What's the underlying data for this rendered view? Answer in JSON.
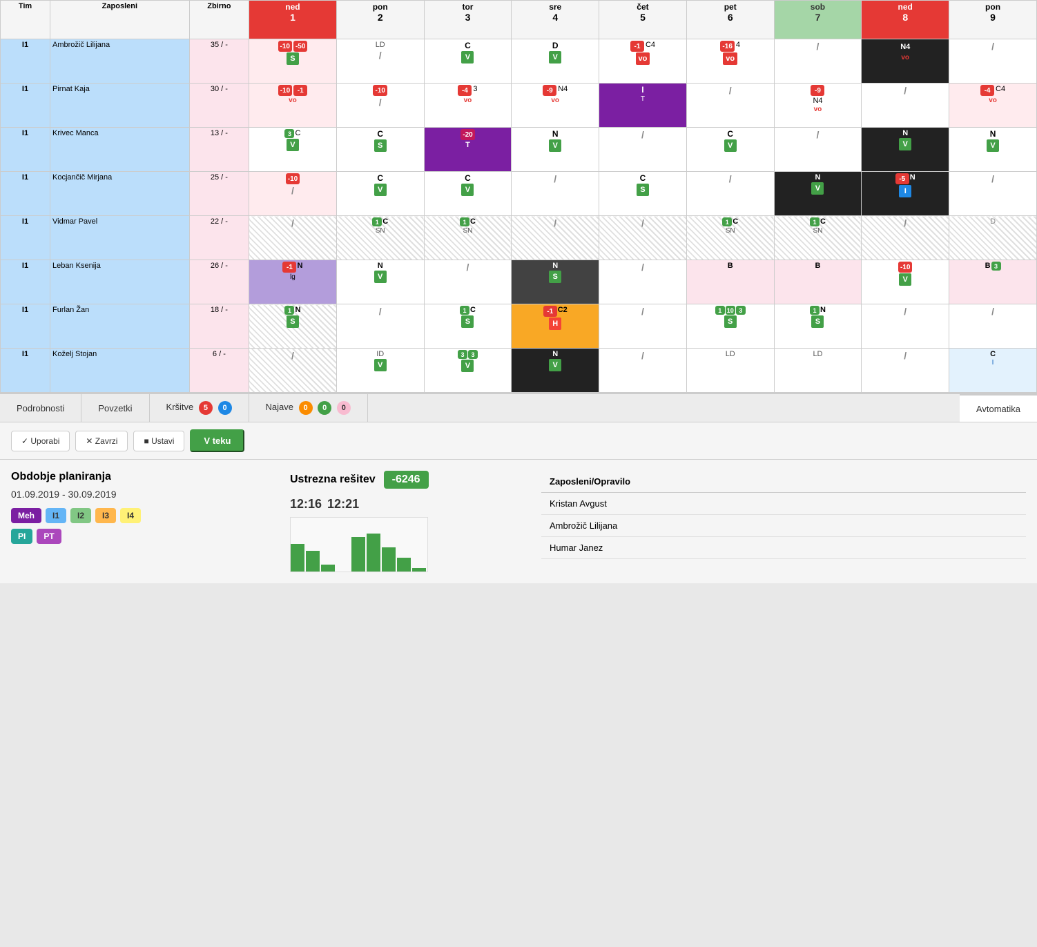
{
  "table": {
    "headers": [
      {
        "label": "Tim",
        "class": "col-tim"
      },
      {
        "label": "Zaposleni",
        "class": "col-zaposleni"
      },
      {
        "label": "Zbirno",
        "class": "col-zbirno"
      },
      {
        "label": "ned",
        "num": "1",
        "class": "header-ned"
      },
      {
        "label": "pon",
        "num": "2",
        "class": ""
      },
      {
        "label": "tor",
        "num": "3",
        "class": ""
      },
      {
        "label": "sre",
        "num": "4",
        "class": ""
      },
      {
        "label": "čet",
        "num": "5",
        "class": ""
      },
      {
        "label": "pet",
        "num": "6",
        "class": ""
      },
      {
        "label": "sob",
        "num": "7",
        "class": "header-sob"
      },
      {
        "label": "ned",
        "num": "8",
        "class": "header-ned"
      },
      {
        "label": "pon",
        "num": "9",
        "class": ""
      }
    ]
  },
  "tabs": {
    "podrobnosti": "Podrobnosti",
    "povzetki": "Povzetki",
    "krsitve": "Kršitve",
    "krsitve_badge1": "5",
    "krsitve_badge2": "0",
    "najave": "Najave",
    "najave_badge1": "0",
    "najave_badge2": "0",
    "najave_badge3": "0",
    "avtomatika": "Avtomatika"
  },
  "actions": {
    "uporabi": "✓ Uporabi",
    "zavrzi": "✕ Zavrzi",
    "ustavi": "■ Ustavi",
    "vteku": "V teku"
  },
  "info": {
    "obdobje_title": "Obdobje planiranja",
    "obdobje_date": "01.09.2019 - 30.09.2019",
    "teams": [
      "Meh",
      "I1",
      "I2",
      "I3",
      "I4",
      "PI",
      "PT"
    ],
    "ustrezna_label": "Ustrezna rešitev",
    "ustrezna_value": "-6246",
    "time1": "12:16",
    "time2": "12:21"
  },
  "employees_right": {
    "title": "Zaposleni/Opravilo",
    "list": [
      "Kristan Avgust",
      "Ambrožič Lilijana",
      "Humar Janez"
    ]
  }
}
